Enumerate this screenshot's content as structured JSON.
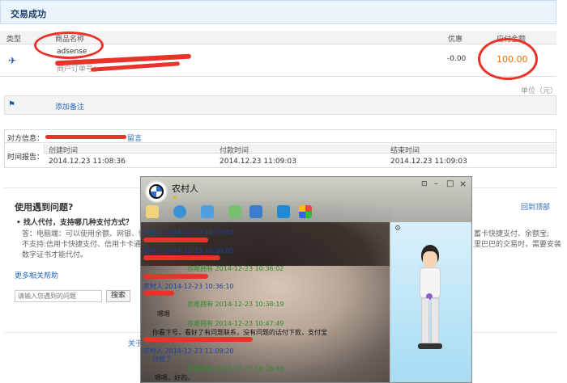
{
  "header": {
    "title": "交易成功"
  },
  "table": {
    "col_type": "类型",
    "col_name": "商品名称",
    "col_discount": "优惠",
    "col_amount": "应付金额",
    "product": "adsense",
    "order_label": "商户订单号：",
    "discount": "-0.00",
    "amount": "100.00",
    "unit": "单位（元）"
  },
  "remark": {
    "label": "添加备注"
  },
  "partner": {
    "label": "对方信息：",
    "message": "留言"
  },
  "time": {
    "label": "时间报告：",
    "created_label": "创建时间",
    "created": "2014.12.23 11:08:36",
    "paid_label": "付款时间",
    "paid": "2014.12.23 11:09:03",
    "end_label": "结束时间",
    "end": "2014.12.23 11:09:03"
  },
  "help": {
    "title": "使用遇到问题?",
    "back_top": "回到顶部",
    "q1": "• 找人代付，支持哪几种支付方式？",
    "a1_line1": "答：电脑端：可以使用余额、网银、快捷",
    "a1_line2": "不支持:信用卡快捷支付、信用卡卡通。",
    "a1_line3": "数字证书才能代付。",
    "a1_right1": "蓄卡快捷支付、余额宝;",
    "a1_right2": "里巴巴的交易时，需要安装",
    "more": "更多相关帮助",
    "search_placeholder": "请输入您遇到的问题",
    "search_btn": "搜索",
    "footer_partial": "关于"
  },
  "chat": {
    "title": "农村人",
    "messages": [
      {
        "who": "农村人",
        "time": "2014-12-23 10:35:42",
        "kind": "self",
        "text": ""
      },
      {
        "who": "农村人",
        "time": "2014-12-23 10:36:00",
        "kind": "self",
        "text": ""
      },
      {
        "who": "亦难拥有",
        "time": "2014-12-23 10:36:02",
        "kind": "other",
        "text": ""
      },
      {
        "who": "农村人",
        "time": "2014-12-23 10:36:10",
        "kind": "self",
        "text": ""
      },
      {
        "who": "亦难拥有",
        "time": "2014-12-23 10:38:19",
        "kind": "other",
        "text": "嗯嗯"
      },
      {
        "who": "亦难拥有",
        "time": "2014-12-23 10:47:49",
        "kind": "other",
        "text": "你看下号，看好了有问题联系，没有问题的话付下款，支付宝"
      },
      {
        "who": "农村人",
        "time": "2014-12-23 11:09:20",
        "kind": "self",
        "text": "付款了"
      },
      {
        "who": "亦难拥有",
        "time": "2014-12-23 16:26:46",
        "kind": "other",
        "text": "嗯嗯，好的。"
      }
    ]
  }
}
